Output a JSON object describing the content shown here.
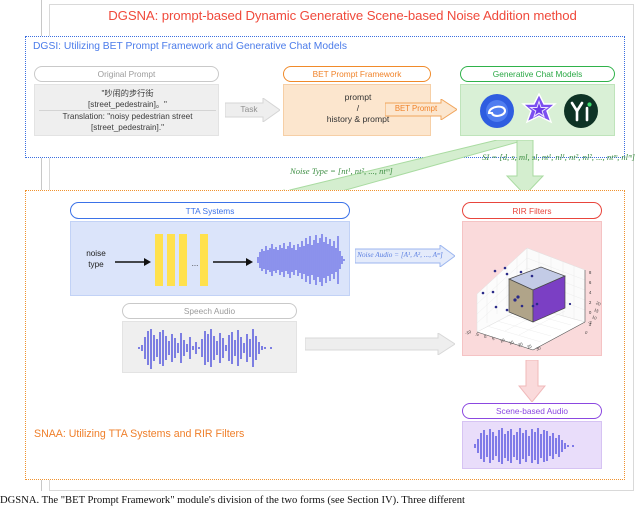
{
  "title": "DGSNA: prompt-based Dynamic Generative Scene-based Noise Addition method",
  "sections": {
    "dgsi": {
      "label": "DGSI: Utilizing BET Prompt Framework and Generative Chat Models"
    },
    "snaa": {
      "label": "SNAA: Utilizing TTA Systems and RIR Filters"
    }
  },
  "modules": {
    "original_prompt": {
      "caption": "Original Prompt",
      "line1": "\"吵闹的步行街",
      "line2": "[street_pedestrain]。\"",
      "line3": "Translation: \"noisy pedestrian street",
      "line4": "[street_pedestrain].\""
    },
    "bet_prompt_framework": {
      "caption": "BET Prompt Framework",
      "line1": "prompt",
      "line2": "/",
      "line3": "history & prompt"
    },
    "generative_chat_models": {
      "caption": "Generative Chat Models",
      "logos": [
        "spark-logo",
        "zhipu-logo",
        "yi-logo"
      ],
      "yi_text": "Yi"
    },
    "tta_systems": {
      "caption": "TTA Systems",
      "input_label_line1": "noise",
      "input_label_line2": "type",
      "ellipsis": "..."
    },
    "speech_audio": {
      "caption": "Speech Audio"
    },
    "rir_filters": {
      "caption": "RIR Filters",
      "x_ticks": [
        "-10",
        "-5",
        "0",
        "5",
        "10",
        "15",
        "20",
        "25",
        "30"
      ],
      "y_ticks": [
        "0",
        "5",
        "10",
        "15",
        "20"
      ],
      "z_ticks": [
        "-2",
        "0",
        "2",
        "4",
        "6",
        "8"
      ]
    },
    "scene_based_audio": {
      "caption": "Scene-based Audio"
    }
  },
  "arrows": {
    "task": "Task",
    "bet_prompt": "BET Prompt",
    "noise_audio": "Noise Audio = [A¹, A², ..., Aᵐ]",
    "si_formula": "SI = [d, s, ml, sl, nt¹, nl¹, nt², nl², ..., ntᵐ, nlᵐ]",
    "noise_type_formula": "Noise Type = [nt¹, nt², ..., ntᵐ]"
  },
  "caption": "DGSNA. The \"BET Prompt Framework\" module's division of the two forms (see Section IV). Three different",
  "colors": {
    "title": "#f04a3c",
    "dgsi": "#4a7bea",
    "snaa": "#ef7f2a",
    "tta": "#3b72e8",
    "rir": "#e8453c",
    "scene": "#8b48e0",
    "green": "#2aa845",
    "orange": "#f0832a",
    "waveform": "#1f22d8",
    "bars": "#ffe14d"
  }
}
